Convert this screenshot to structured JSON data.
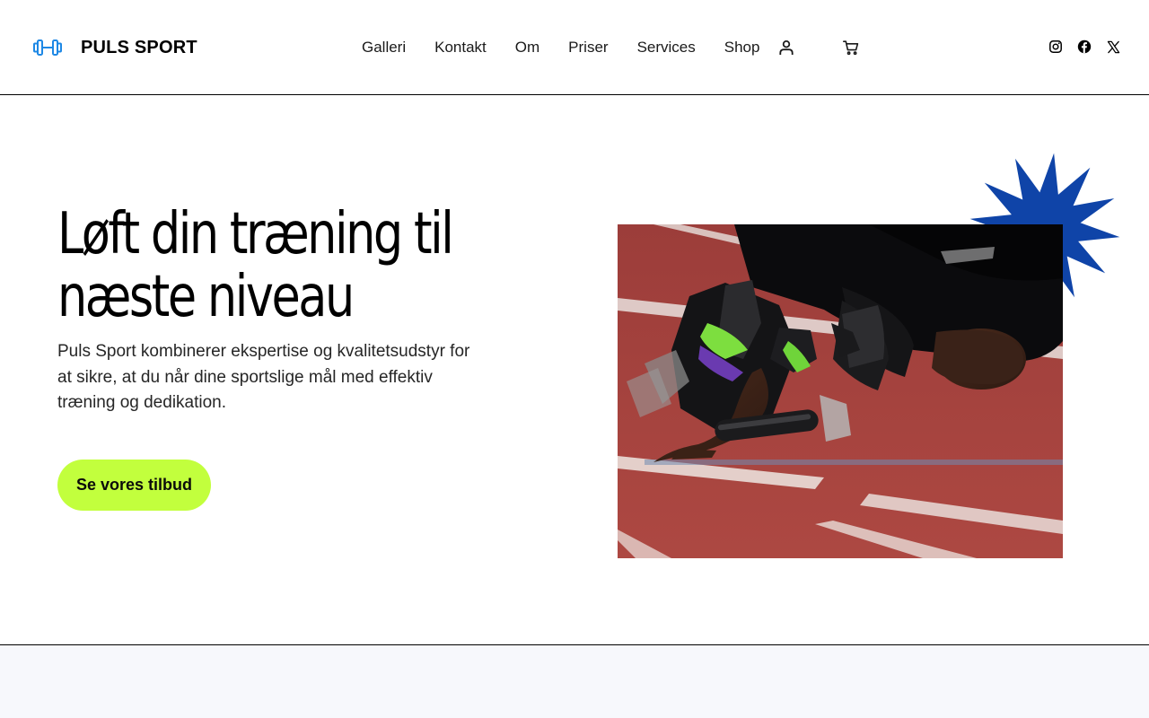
{
  "header": {
    "brand": "PULS SPORT",
    "logo_icon": "dumbbell-icon",
    "nav": [
      {
        "label": "Galleri"
      },
      {
        "label": "Kontakt"
      },
      {
        "label": "Om"
      },
      {
        "label": "Priser"
      },
      {
        "label": "Services"
      },
      {
        "label": "Shop"
      }
    ],
    "account_icon": "user-icon",
    "cart_icon": "cart-icon",
    "social_icons": [
      "instagram-icon",
      "facebook-icon",
      "x-icon"
    ]
  },
  "hero": {
    "title_line1": "Løft din træning til",
    "title_line2": "næste niveau",
    "description": "Puls Sport kombinerer ekspertise og kvalitetsudstyr for at sikre, at du når dine sportslige mål med effektiv træning og dedikation.",
    "cta_label": "Se vores tilbud",
    "image_subject": "runner-starting-blocks-photo"
  },
  "colors": {
    "accent_lime": "#c2ff3d",
    "accent_blue": "#0f44a8",
    "logo_blue": "#1e88e5",
    "track_red": "#a8403d",
    "bottom_band": "#f7f8fc"
  }
}
